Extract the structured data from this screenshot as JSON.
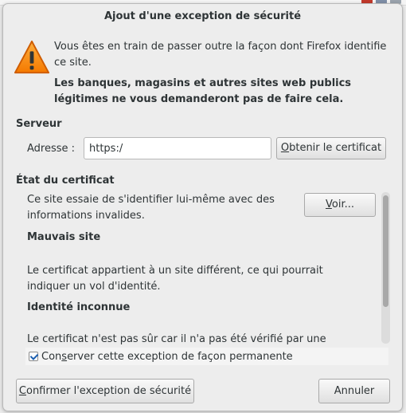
{
  "window": {
    "title": "Ajout d'une exception de sécurité"
  },
  "intro": {
    "icon": "warning-triangle-icon",
    "text1": "Vous êtes en train de passer outre la façon dont Firefox identifie ce site.",
    "text2": "Les banques, magasins et autres sites web publics légitimes ne vous demanderont pas de faire cela."
  },
  "server": {
    "title": "Serveur",
    "address_label": "Adresse :",
    "address_value": "https:/",
    "get_cert": {
      "before": "",
      "key": "O",
      "after": "btenir le certificat"
    }
  },
  "certificate": {
    "title": "État du certificat",
    "invalid_text": "Ce site essaie de s'identifier lui-même avec des informations invalides.",
    "view": {
      "before": "",
      "key": "V",
      "after": "oir..."
    },
    "bad_site_title": "Mauvais site",
    "bad_site_text": "Le certificat appartient à un site différent, ce qui pourrait indiquer un vol d'identité.",
    "unknown_title": "Identité inconnue",
    "unknown_text": "Le certificat n'est pas sûr car il n'a pas été vérifié par une autorité"
  },
  "permanent": {
    "checked": true,
    "label": {
      "before": "Con",
      "key": "s",
      "after": "erver cette exception de façon permanente"
    }
  },
  "footer": {
    "confirm": {
      "before": "",
      "key": "C",
      "after": "onfirmer l'exception de sécurité"
    },
    "cancel": "Annuler"
  },
  "colors": {
    "warning_orange": "#f57900",
    "accent_blue": "#1c5fb0"
  }
}
